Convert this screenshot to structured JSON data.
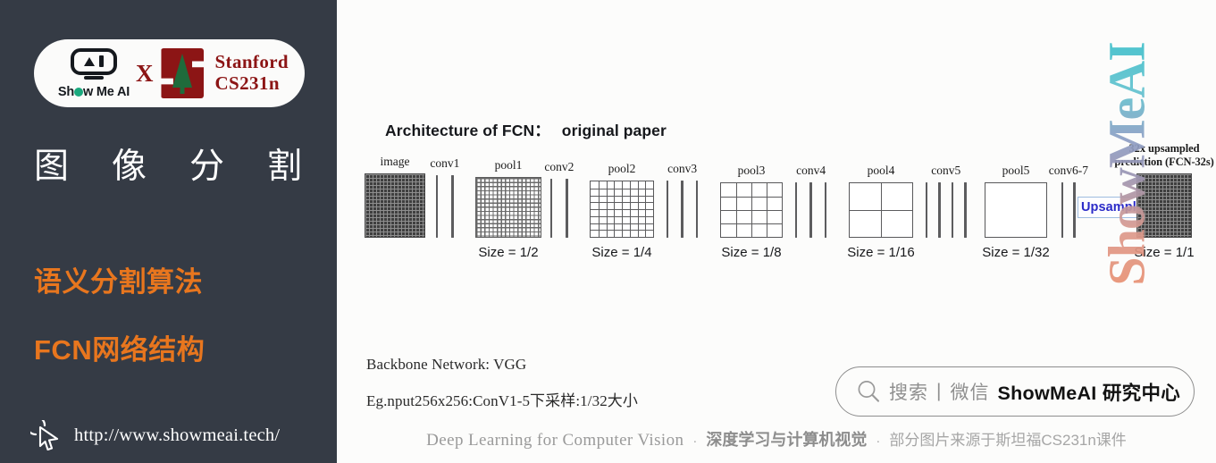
{
  "sidebar": {
    "badge": {
      "brand_name": "Show Me AI",
      "separator": "X",
      "partner_line1": "Stanford",
      "partner_line2": "CS231n"
    },
    "title_chars": [
      "图",
      "像",
      "分",
      "割"
    ],
    "subtitle1": "语义分割算法",
    "subtitle2": "FCN网络结构",
    "site_url": "http://www.showmeai.tech/"
  },
  "main": {
    "diagram_title_left": "Architecture of FCN：",
    "diagram_title_right": "original paper",
    "upsample_label": "Upsample",
    "final_label_line1": "32x upsampled",
    "final_label_line2": "prediction (FCN-32s)",
    "stages": [
      {
        "label": "image",
        "size": ""
      },
      {
        "label": "conv1",
        "size": ""
      },
      {
        "label": "pool1",
        "size": "Size = 1/2"
      },
      {
        "label": "conv2",
        "size": ""
      },
      {
        "label": "pool2",
        "size": "Size = 1/4"
      },
      {
        "label": "conv3",
        "size": ""
      },
      {
        "label": "pool3",
        "size": "Size = 1/8"
      },
      {
        "label": "conv4",
        "size": ""
      },
      {
        "label": "pool4",
        "size": "Size = 1/16"
      },
      {
        "label": "conv5",
        "size": ""
      },
      {
        "label": "pool5",
        "size": "Size = 1/32"
      },
      {
        "label": "conv6-7",
        "size": ""
      },
      {
        "label": "",
        "size": "Size = 1/1"
      }
    ],
    "notes": [
      "Backbone Network: VGG",
      "Eg.nput256x256:ConV1-5下采样:1/32大小"
    ],
    "search_pill": {
      "search_text": "搜索",
      "divider": "|",
      "channel_text": "微信",
      "account_text": "ShowMeAI 研究中心"
    },
    "footer": {
      "english": "Deep Learning for Computer Vision",
      "dot1": "·",
      "chinese_bold": "深度学习与计算机视觉",
      "dot2": "·",
      "chinese_light": "部分图片来源于斯坦福CS231n课件"
    },
    "watermark": "ShowMeAI"
  },
  "colors": {
    "sidebar_bg": "#353b45",
    "accent_orange": "#e8761e",
    "stanford_red": "#8c1515",
    "upsample_blue": "#2b2bc8",
    "main_bg": "#fcfcfb"
  }
}
